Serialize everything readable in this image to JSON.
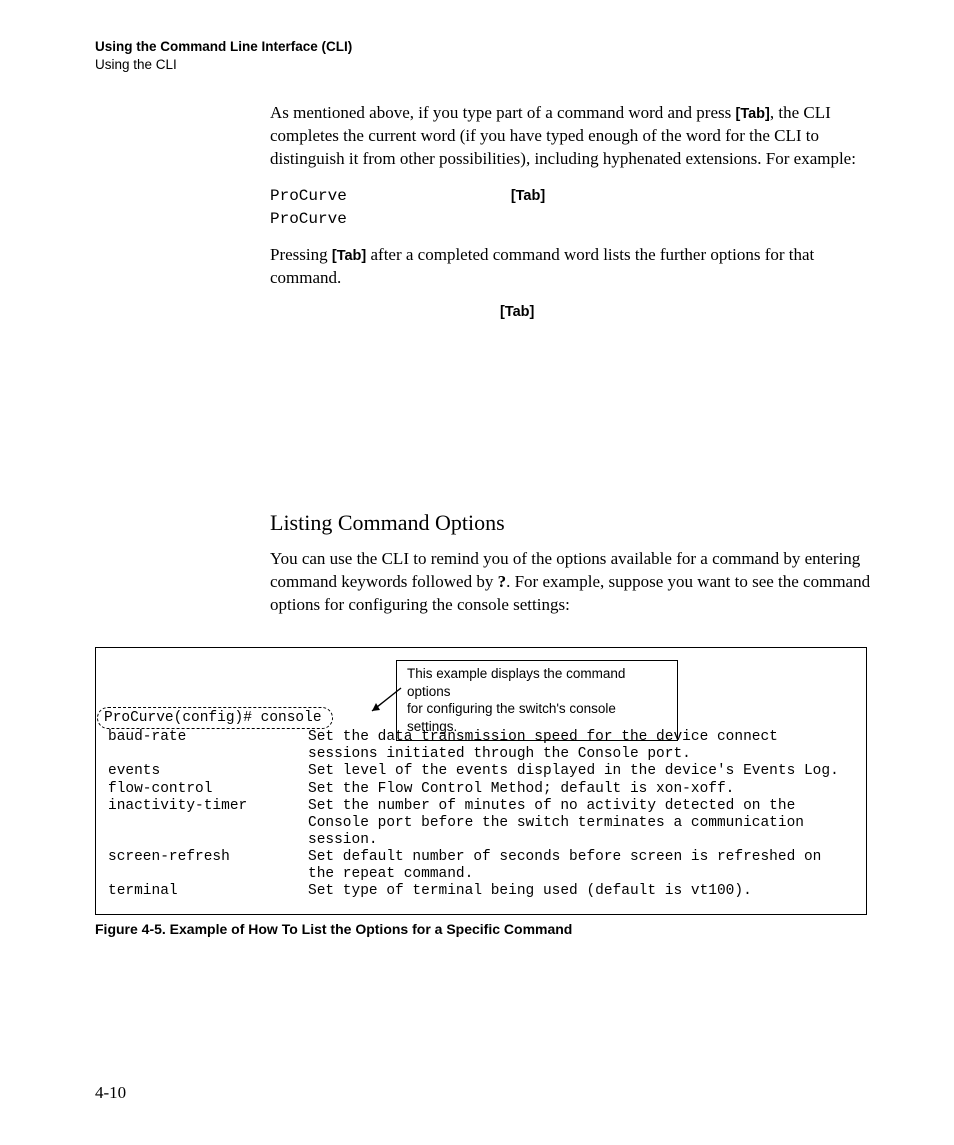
{
  "header": {
    "title": "Using the Command Line Interface (CLI)",
    "subtitle": "Using the CLI"
  },
  "p1_a": "As mentioned above, if you type part of a command word and press ",
  "p1_tab": "[Tab]",
  "p1_b": ", the CLI completes the current word (if you have typed enough of the word for the CLI to distinguish it from other possibilities), including hyphenated exten­sions. For example:",
  "code1_line1": "ProCurve",
  "code1_tab": "[Tab]",
  "code1_line2": "ProCurve",
  "p2_a": "Pressing ",
  "p2_tab": "[Tab]",
  "p2_b": " after a completed command word lists the further options for that command.",
  "tab_only": "[Tab]",
  "section_heading": "Listing Command Options",
  "p3_a": "You can use the CLI to remind you of the options available for a command by entering command keywords followed by ",
  "p3_q": "?",
  "p3_b": ". For example, suppose you want to see the command options for configuring the console settings:",
  "callout_l1": "This example displays the command options",
  "callout_l2": "for configuring the switch's console settings.",
  "prompt": "ProCurve(config)# console ",
  "options": [
    {
      "k": "baud-rate",
      "d": "Set the data transmission speed for the device connect sessions initiated through the Console port."
    },
    {
      "k": "events",
      "d": "Set level of the events displayed in the device's Events Log."
    },
    {
      "k": "flow-control",
      "d": "Set the Flow Control Method; default is xon-xoff."
    },
    {
      "k": "inactivity-timer",
      "d": "Set the number of minutes of no activity detected on the Console port before the switch terminates a communication session."
    },
    {
      "k": "screen-refresh",
      "d": "Set default number of seconds before screen is refreshed on the repeat command."
    },
    {
      "k": "terminal",
      "d": "Set type of terminal being used (default is vt100)."
    }
  ],
  "figure_caption": "Figure 4-5.   Example of How To List the Options for a Specific Command",
  "page_number": "4-10"
}
